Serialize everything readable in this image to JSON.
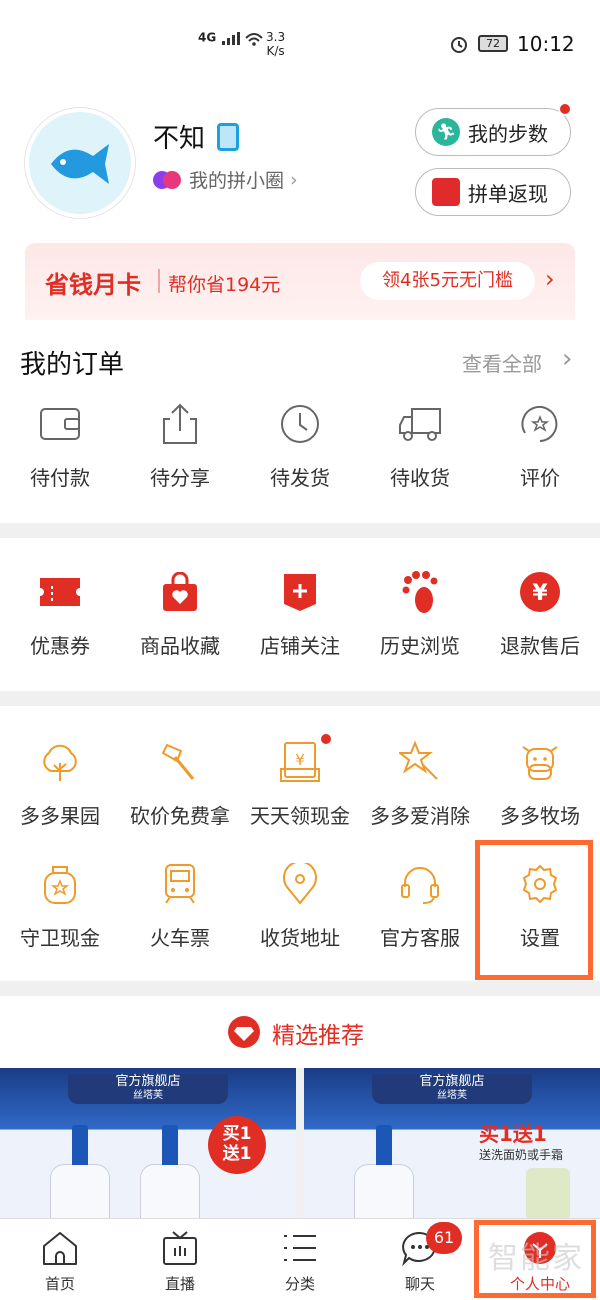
{
  "status_bar": {
    "network": "4G",
    "speed": "3.3\nK/s",
    "battery": "72",
    "time": "10:12"
  },
  "profile": {
    "username": "不知",
    "circle_label": "我的拼小圈",
    "steps_button": "我的步数",
    "return_button": "拼单返现"
  },
  "month_card": {
    "title": "省钱月卡",
    "subtitle": "帮你省194元",
    "action": "领4张5元无门槛"
  },
  "orders": {
    "title": "我的订单",
    "view_all": "查看全部",
    "items": [
      {
        "label": "待付款",
        "icon": "wallet-icon"
      },
      {
        "label": "待分享",
        "icon": "share-icon"
      },
      {
        "label": "待发货",
        "icon": "clock-icon"
      },
      {
        "label": "待收货",
        "icon": "truck-icon"
      },
      {
        "label": "评价",
        "icon": "review-icon"
      }
    ]
  },
  "tools": {
    "items": [
      {
        "label": "优惠券",
        "icon": "coupon-icon"
      },
      {
        "label": "商品收藏",
        "icon": "favorite-bag-icon"
      },
      {
        "label": "店铺关注",
        "icon": "store-follow-icon"
      },
      {
        "label": "历史浏览",
        "icon": "footprint-icon"
      },
      {
        "label": "退款售后",
        "icon": "refund-icon"
      }
    ]
  },
  "services": {
    "row1": [
      {
        "label": "多多果园",
        "icon": "tree-icon"
      },
      {
        "label": "砍价免费拿",
        "icon": "axe-icon"
      },
      {
        "label": "天天领现金",
        "icon": "cash-envelope-icon"
      },
      {
        "label": "多多爱消除",
        "icon": "star-wand-icon"
      },
      {
        "label": "多多牧场",
        "icon": "cow-icon"
      }
    ],
    "row2": [
      {
        "label": "守卫现金",
        "icon": "money-bag-icon"
      },
      {
        "label": "火车票",
        "icon": "train-icon"
      },
      {
        "label": "收货地址",
        "icon": "location-icon"
      },
      {
        "label": "官方客服",
        "icon": "headset-icon"
      },
      {
        "label": "设置",
        "icon": "gear-icon"
      }
    ]
  },
  "recommend": {
    "title": "精选推荐"
  },
  "products": {
    "left": {
      "store": "官方旗舰店",
      "brand": "丝塔芙",
      "badge": "买1\n送1"
    },
    "right": {
      "store": "官方旗舰店",
      "brand": "丝塔芙",
      "promo": "买1送1",
      "promo_sub": "送洗面奶或手霜"
    }
  },
  "tabbar": {
    "items": [
      {
        "label": "首页",
        "icon": "home-icon"
      },
      {
        "label": "直播",
        "icon": "tv-icon"
      },
      {
        "label": "分类",
        "icon": "list-icon"
      },
      {
        "label": "聊天",
        "icon": "chat-icon"
      },
      {
        "label": "个人中心",
        "icon": "profile-icon"
      }
    ],
    "chat_badge": "61",
    "watermark": "智能家"
  },
  "colors": {
    "accent": "#e02e24",
    "service": "#f09a2b",
    "highlight": "#ff6a33"
  }
}
